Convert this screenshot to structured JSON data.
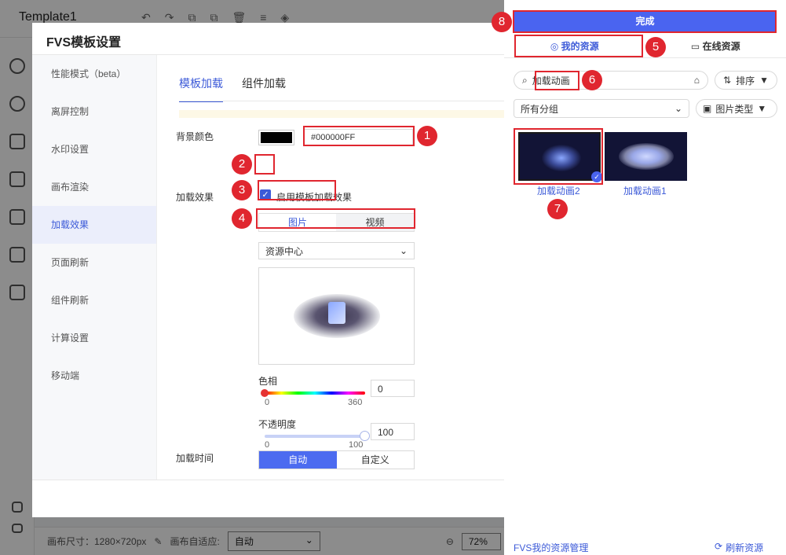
{
  "app": {
    "title": "Template1",
    "canvas_size_label": "画布尺寸：1280×720px",
    "canvas_fit_label": "画布自适应:",
    "canvas_fit_value": "自动",
    "zoom": "72%"
  },
  "modal": {
    "title": "FVS模板设置",
    "menu": [
      "性能模式（beta）",
      "离屏控制",
      "水印设置",
      "画布渲染",
      "加载效果",
      "页面刷新",
      "组件刷新",
      "计算设置",
      "移动端"
    ],
    "active_menu_index": 4,
    "tabs": [
      "模板加载",
      "组件加载"
    ],
    "bg_color_label": "背景颜色",
    "bg_color_value": "#000000FF",
    "effect_label": "加载效果",
    "enable_label": "启用模板加载效果",
    "media_tabs": [
      "图片",
      "视频"
    ],
    "source_value": "资源中心",
    "hue_label": "色相",
    "hue_min": "0",
    "hue_max": "360",
    "hue_value": "0",
    "opacity_label": "不透明度",
    "opacity_min": "0",
    "opacity_max": "100",
    "opacity_value": "100",
    "time_label": "加载时间",
    "time_options": [
      "自动",
      "自定义"
    ]
  },
  "panel": {
    "done_label": "完成",
    "tab_mine": "我的资源",
    "tab_online": "在线资源",
    "search_value": "加载动画",
    "sort_label": "排序",
    "group_value": "所有分组",
    "type_label": "图片类型",
    "items": [
      {
        "name": "加载动画2",
        "selected": true
      },
      {
        "name": "加载动画1",
        "selected": false
      }
    ],
    "manage_label": "FVS我的资源管理",
    "refresh_label": "刷新资源"
  },
  "annotations": [
    "1",
    "2",
    "3",
    "4",
    "5",
    "6",
    "7",
    "8"
  ],
  "colors": {
    "accent": "#4a64f0",
    "annotation": "#e0262f"
  }
}
